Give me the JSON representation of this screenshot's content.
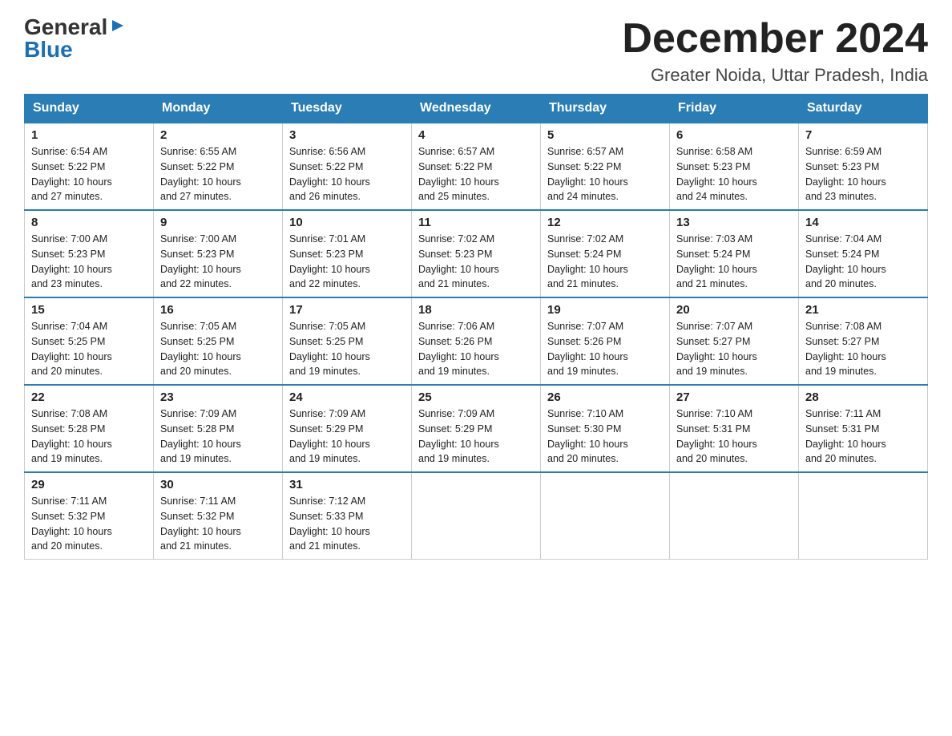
{
  "logo": {
    "general": "General",
    "blue": "Blue"
  },
  "title": "December 2024",
  "location": "Greater Noida, Uttar Pradesh, India",
  "days_of_week": [
    "Sunday",
    "Monday",
    "Tuesday",
    "Wednesday",
    "Thursday",
    "Friday",
    "Saturday"
  ],
  "weeks": [
    [
      {
        "day": "1",
        "sunrise": "6:54 AM",
        "sunset": "5:22 PM",
        "daylight": "10 hours and 27 minutes."
      },
      {
        "day": "2",
        "sunrise": "6:55 AM",
        "sunset": "5:22 PM",
        "daylight": "10 hours and 27 minutes."
      },
      {
        "day": "3",
        "sunrise": "6:56 AM",
        "sunset": "5:22 PM",
        "daylight": "10 hours and 26 minutes."
      },
      {
        "day": "4",
        "sunrise": "6:57 AM",
        "sunset": "5:22 PM",
        "daylight": "10 hours and 25 minutes."
      },
      {
        "day": "5",
        "sunrise": "6:57 AM",
        "sunset": "5:22 PM",
        "daylight": "10 hours and 24 minutes."
      },
      {
        "day": "6",
        "sunrise": "6:58 AM",
        "sunset": "5:23 PM",
        "daylight": "10 hours and 24 minutes."
      },
      {
        "day": "7",
        "sunrise": "6:59 AM",
        "sunset": "5:23 PM",
        "daylight": "10 hours and 23 minutes."
      }
    ],
    [
      {
        "day": "8",
        "sunrise": "7:00 AM",
        "sunset": "5:23 PM",
        "daylight": "10 hours and 23 minutes."
      },
      {
        "day": "9",
        "sunrise": "7:00 AM",
        "sunset": "5:23 PM",
        "daylight": "10 hours and 22 minutes."
      },
      {
        "day": "10",
        "sunrise": "7:01 AM",
        "sunset": "5:23 PM",
        "daylight": "10 hours and 22 minutes."
      },
      {
        "day": "11",
        "sunrise": "7:02 AM",
        "sunset": "5:23 PM",
        "daylight": "10 hours and 21 minutes."
      },
      {
        "day": "12",
        "sunrise": "7:02 AM",
        "sunset": "5:24 PM",
        "daylight": "10 hours and 21 minutes."
      },
      {
        "day": "13",
        "sunrise": "7:03 AM",
        "sunset": "5:24 PM",
        "daylight": "10 hours and 21 minutes."
      },
      {
        "day": "14",
        "sunrise": "7:04 AM",
        "sunset": "5:24 PM",
        "daylight": "10 hours and 20 minutes."
      }
    ],
    [
      {
        "day": "15",
        "sunrise": "7:04 AM",
        "sunset": "5:25 PM",
        "daylight": "10 hours and 20 minutes."
      },
      {
        "day": "16",
        "sunrise": "7:05 AM",
        "sunset": "5:25 PM",
        "daylight": "10 hours and 20 minutes."
      },
      {
        "day": "17",
        "sunrise": "7:05 AM",
        "sunset": "5:25 PM",
        "daylight": "10 hours and 19 minutes."
      },
      {
        "day": "18",
        "sunrise": "7:06 AM",
        "sunset": "5:26 PM",
        "daylight": "10 hours and 19 minutes."
      },
      {
        "day": "19",
        "sunrise": "7:07 AM",
        "sunset": "5:26 PM",
        "daylight": "10 hours and 19 minutes."
      },
      {
        "day": "20",
        "sunrise": "7:07 AM",
        "sunset": "5:27 PM",
        "daylight": "10 hours and 19 minutes."
      },
      {
        "day": "21",
        "sunrise": "7:08 AM",
        "sunset": "5:27 PM",
        "daylight": "10 hours and 19 minutes."
      }
    ],
    [
      {
        "day": "22",
        "sunrise": "7:08 AM",
        "sunset": "5:28 PM",
        "daylight": "10 hours and 19 minutes."
      },
      {
        "day": "23",
        "sunrise": "7:09 AM",
        "sunset": "5:28 PM",
        "daylight": "10 hours and 19 minutes."
      },
      {
        "day": "24",
        "sunrise": "7:09 AM",
        "sunset": "5:29 PM",
        "daylight": "10 hours and 19 minutes."
      },
      {
        "day": "25",
        "sunrise": "7:09 AM",
        "sunset": "5:29 PM",
        "daylight": "10 hours and 19 minutes."
      },
      {
        "day": "26",
        "sunrise": "7:10 AM",
        "sunset": "5:30 PM",
        "daylight": "10 hours and 20 minutes."
      },
      {
        "day": "27",
        "sunrise": "7:10 AM",
        "sunset": "5:31 PM",
        "daylight": "10 hours and 20 minutes."
      },
      {
        "day": "28",
        "sunrise": "7:11 AM",
        "sunset": "5:31 PM",
        "daylight": "10 hours and 20 minutes."
      }
    ],
    [
      {
        "day": "29",
        "sunrise": "7:11 AM",
        "sunset": "5:32 PM",
        "daylight": "10 hours and 20 minutes."
      },
      {
        "day": "30",
        "sunrise": "7:11 AM",
        "sunset": "5:32 PM",
        "daylight": "10 hours and 21 minutes."
      },
      {
        "day": "31",
        "sunrise": "7:12 AM",
        "sunset": "5:33 PM",
        "daylight": "10 hours and 21 minutes."
      },
      null,
      null,
      null,
      null
    ]
  ],
  "labels": {
    "sunrise": "Sunrise:",
    "sunset": "Sunset:",
    "daylight": "Daylight:"
  }
}
